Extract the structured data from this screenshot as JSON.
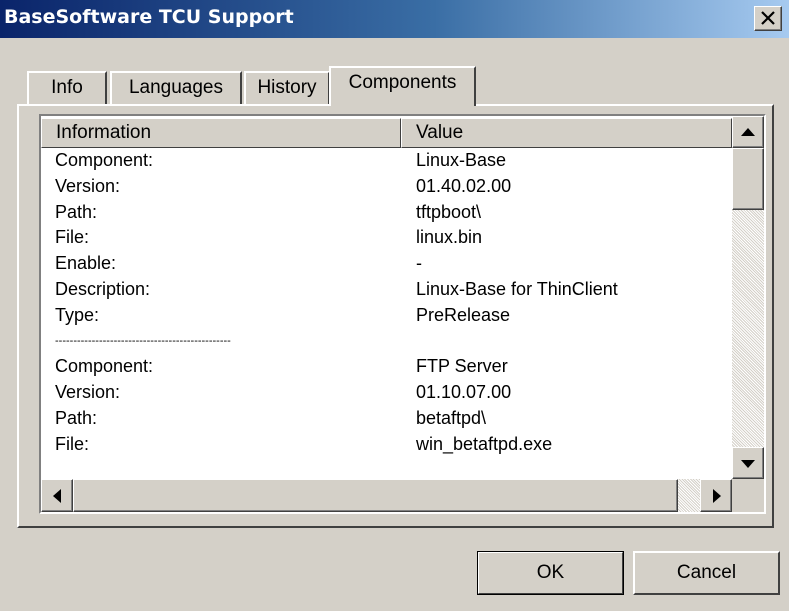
{
  "window": {
    "title": "BaseSoftware TCU Support"
  },
  "tabs": [
    {
      "label": "Info",
      "active": false
    },
    {
      "label": "Languages",
      "active": false
    },
    {
      "label": "History",
      "active": false
    },
    {
      "label": "Components",
      "active": true
    }
  ],
  "list": {
    "columns": [
      "Information",
      "Value"
    ],
    "rows": [
      {
        "info": "Component:",
        "value": "Linux-Base"
      },
      {
        "info": "Version:",
        "value": "01.40.02.00"
      },
      {
        "info": "Path:",
        "value": "tftpboot\\"
      },
      {
        "info": "File:",
        "value": "linux.bin"
      },
      {
        "info": "Enable:",
        "value": "-"
      },
      {
        "info": "Description:",
        "value": "Linux-Base for ThinClient"
      },
      {
        "info": "Type:",
        "value": "PreRelease"
      },
      {
        "info": "------------------------------------------------",
        "value": ""
      },
      {
        "info": "Component:",
        "value": "FTP Server"
      },
      {
        "info": "Version:",
        "value": "01.10.07.00"
      },
      {
        "info": "Path:",
        "value": "betaftpd\\"
      },
      {
        "info": "File:",
        "value": "win_betaftpd.exe"
      }
    ]
  },
  "buttons": {
    "ok": "OK",
    "cancel": "Cancel"
  },
  "icons": {
    "close": "close-icon",
    "scroll_up": "arrow-up-icon",
    "scroll_down": "arrow-down-icon",
    "scroll_left": "arrow-left-icon",
    "scroll_right": "arrow-right-icon"
  },
  "colors": {
    "title_gradient_start": "#0a246a",
    "title_gradient_end": "#a6caf0",
    "face": "#d4d0c8"
  }
}
